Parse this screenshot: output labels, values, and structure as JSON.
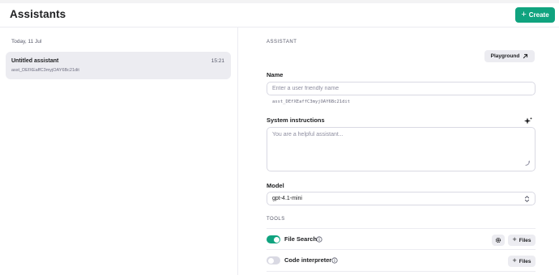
{
  "header": {
    "title": "Assistants",
    "create_label": "Create",
    "create_icon": "plus-icon",
    "accent_color": "#10a37f"
  },
  "list": {
    "date_label": "Today, 11 Jul",
    "items": [
      {
        "name": "Untitled assistant",
        "id": "asst_DEfXEaffC3myjOAY6Bc21dit",
        "time": "15:21",
        "selected": true
      }
    ]
  },
  "editor": {
    "section_label": "ASSISTANT",
    "playground_label": "Playground",
    "playground_icon": "arrow-up-right-icon",
    "name_label": "Name",
    "name_placeholder": "Enter a user friendly name",
    "name_value": "",
    "assistant_id": "asst_DEfXEaffC3myjOAY6Bc21dit",
    "instructions_label": "System instructions",
    "instructions_placeholder": "You are a helpful assistant...",
    "instructions_value": "",
    "model_label": "Model",
    "model_value": "gpt-4.1-mini",
    "tools_label": "TOOLS",
    "tools": [
      {
        "label": "File Search",
        "enabled": true,
        "has_settings": true,
        "files_label": "Files"
      },
      {
        "label": "Code interpreter",
        "enabled": false,
        "has_settings": false,
        "files_label": "Files"
      }
    ]
  }
}
